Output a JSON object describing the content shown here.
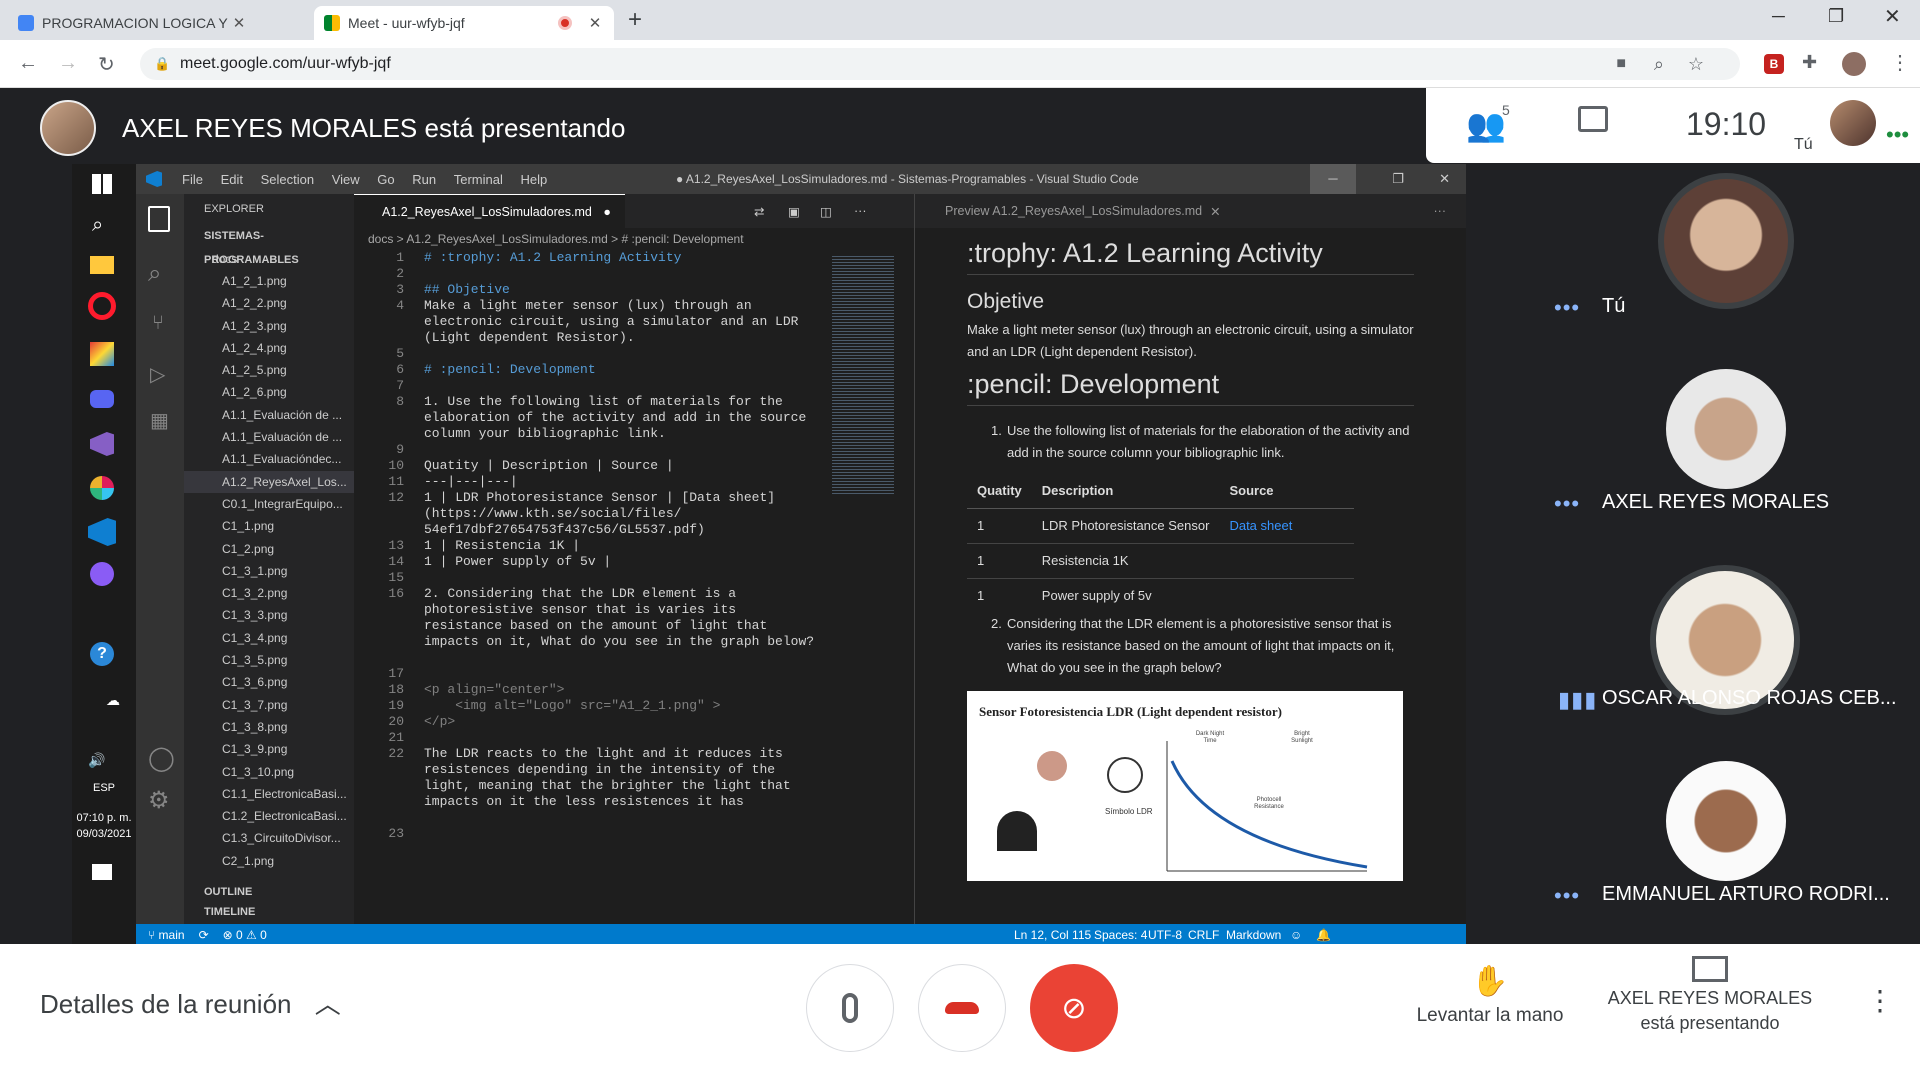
{
  "browser": {
    "tabs": [
      {
        "title": "PROGRAMACION LOGICA Y FUN",
        "icon": "classroom-icon",
        "active": false
      },
      {
        "title": "Meet - uur-wfyb-jqf",
        "icon": "meet-icon",
        "active": true
      }
    ],
    "url": "meet.google.com/uur-wfyb-jqf",
    "ext_badge": "B"
  },
  "meet": {
    "presenting_text": "AXEL REYES MORALES está presentando",
    "participants_count": "5",
    "time": "19:10",
    "you_label": "Tú",
    "participants": [
      {
        "name": "Tú",
        "status": "dots"
      },
      {
        "name": "AXEL REYES MORALES",
        "status": "dots"
      },
      {
        "name": "OSCAR ALONSO ROJAS CEB...",
        "status": "speaking"
      },
      {
        "name": "EMMANUEL ARTURO RODRI...",
        "status": "dots"
      }
    ],
    "details_label": "Detalles de la reunión",
    "raise_hand_label": "Levantar la mano",
    "presenting_line1": "AXEL REYES MORALES",
    "presenting_line2": "está presentando"
  },
  "taskbar": {
    "lang": "ESP",
    "time": "07:10 p. m.",
    "date": "09/03/2021"
  },
  "vscode": {
    "menu": [
      "File",
      "Edit",
      "Selection",
      "View",
      "Go",
      "Run",
      "Terminal",
      "Help"
    ],
    "title": "● A1.2_ReyesAxel_LosSimuladores.md - Sistemas-Programables - Visual Studio Code",
    "explorer_title": "EXPLORER",
    "workspace": "SISTEMAS-PROGRAMABLES",
    "folder": "docs",
    "files": [
      "A1_2_1.png",
      "A1_2_2.png",
      "A1_2_3.png",
      "A1_2_4.png",
      "A1_2_5.png",
      "A1_2_6.png",
      "A1.1_Evaluación de ...",
      "A1.1_Evaluación de ...",
      "A1.1_Evaluacióndec...",
      "A1.2_ReyesAxel_Los...",
      "C0.1_IntegrarEquipo...",
      "C1_1.png",
      "C1_2.png",
      "C1_3_1.png",
      "C1_3_2.png",
      "C1_3_3.png",
      "C1_3_4.png",
      "C1_3_5.png",
      "C1_3_6.png",
      "C1_3_7.png",
      "C1_3_8.png",
      "C1_3_9.png",
      "C1_3_10.png",
      "C1.1_ElectronicaBasi...",
      "C1.2_ElectronicaBasi...",
      "C1.3_CircuitoDivisor...",
      "C2_1.png"
    ],
    "outline": "OUTLINE",
    "timeline": "TIMELINE",
    "editor_tab": "A1.2_ReyesAxel_LosSimuladores.md",
    "breadcrumb": "docs > A1.2_ReyesAxel_LosSimuladores.md > # :pencil: Development",
    "preview_tab": "Preview A1.2_ReyesAxel_LosSimuladores.md",
    "code_lines": [
      {
        "n": "1",
        "t": "# :trophy: A1.2 Learning Activity",
        "c": "#569cd6"
      },
      {
        "n": "2",
        "t": "",
        "c": "#d4d4d4"
      },
      {
        "n": "3",
        "t": "## Objetive",
        "c": "#569cd6"
      },
      {
        "n": "4",
        "t": "Make a light meter sensor (lux) through an",
        "c": "#d4d4d4"
      },
      {
        "n": "",
        "t": "electronic circuit, using a simulator and an LDR",
        "c": "#d4d4d4"
      },
      {
        "n": "",
        "t": "(Light dependent Resistor).",
        "c": "#d4d4d4"
      },
      {
        "n": "5",
        "t": "",
        "c": "#d4d4d4"
      },
      {
        "n": "6",
        "t": "# :pencil: Development",
        "c": "#569cd6"
      },
      {
        "n": "7",
        "t": "",
        "c": "#d4d4d4"
      },
      {
        "n": "8",
        "t": "1. Use the following list of materials for the",
        "c": "#d4d4d4"
      },
      {
        "n": "",
        "t": "elaboration of the activity and add in the source",
        "c": "#d4d4d4"
      },
      {
        "n": "",
        "t": "column your bibliographic link.",
        "c": "#d4d4d4"
      },
      {
        "n": "9",
        "t": "",
        "c": "#d4d4d4"
      },
      {
        "n": "10",
        "t": "Quatity | Description | Source |",
        "c": "#d4d4d4"
      },
      {
        "n": "11",
        "t": "---|---|---|",
        "c": "#d4d4d4"
      },
      {
        "n": "12",
        "t": "1 | LDR Photoresistance Sensor | [Data sheet]",
        "c": "#d4d4d4"
      },
      {
        "n": "",
        "t": "(https://www.kth.se/social/files/",
        "c": "#d4d4d4"
      },
      {
        "n": "",
        "t": "54ef17dbf27654753f437c56/GL5537.pdf)",
        "c": "#d4d4d4"
      },
      {
        "n": "13",
        "t": "1 | Resistencia 1K |",
        "c": "#d4d4d4"
      },
      {
        "n": "14",
        "t": "1 | Power supply of 5v |",
        "c": "#d4d4d4"
      },
      {
        "n": "15",
        "t": "",
        "c": "#d4d4d4"
      },
      {
        "n": "16",
        "t": "2. Considering that the LDR element is a",
        "c": "#d4d4d4"
      },
      {
        "n": "",
        "t": "photoresistive sensor that is varies its",
        "c": "#d4d4d4"
      },
      {
        "n": "",
        "t": "resistance based on the amount of light that",
        "c": "#d4d4d4"
      },
      {
        "n": "",
        "t": "impacts on it, What do you see in the graph below?",
        "c": "#d4d4d4"
      },
      {
        "n": "",
        "t": "",
        "c": "#d4d4d4"
      },
      {
        "n": "17",
        "t": "",
        "c": "#d4d4d4"
      },
      {
        "n": "18",
        "t": "<p align=\"center\">",
        "c": "#808080"
      },
      {
        "n": "19",
        "t": "    <img alt=\"Logo\" src=\"A1_2_1.png\" >",
        "c": "#808080"
      },
      {
        "n": "20",
        "t": "</p>",
        "c": "#808080"
      },
      {
        "n": "21",
        "t": "",
        "c": "#d4d4d4"
      },
      {
        "n": "22",
        "t": "The LDR reacts to the light and it reduces its",
        "c": "#d4d4d4"
      },
      {
        "n": "",
        "t": "resistences depending in the intensity of the",
        "c": "#d4d4d4"
      },
      {
        "n": "",
        "t": "light, meaning that the brighter the light that",
        "c": "#d4d4d4"
      },
      {
        "n": "",
        "t": "impacts on it the less resistences it has",
        "c": "#d4d4d4"
      },
      {
        "n": "",
        "t": "",
        "c": "#d4d4d4"
      },
      {
        "n": "23",
        "t": "",
        "c": "#d4d4d4"
      }
    ],
    "preview": {
      "h1": ":trophy: A1.2 Learning Activity",
      "h2_objective": "Objetive",
      "objective_text": "Make a light meter sensor (lux) through an electronic circuit, using a simulator and an LDR (Light dependent Resistor).",
      "h1_dev": ":pencil: Development",
      "item1": "Use the following list of materials for the elaboration of the activity and add in the source column your bibliographic link.",
      "table_head": [
        "Quatity",
        "Description",
        "Source"
      ],
      "table_rows": [
        [
          "1",
          "LDR Photoresistance Sensor",
          "Data sheet"
        ],
        [
          "1",
          "Resistencia 1K",
          ""
        ],
        [
          "1",
          "Power supply of 5v",
          ""
        ]
      ],
      "item2": "Considering that the LDR element is a photoresistive sensor that is varies its resistance based on the amount of light that impacts on it, What do you see in the graph below?",
      "image_caption": "Sensor Fotoresistencia LDR (Light dependent resistor)",
      "image_label_symbol": "Símbolo LDR",
      "image_label_curve": "Photocell Resistance",
      "image_label_dark": "Dark Night Time",
      "image_label_bright": "Bright Sunlight"
    },
    "status": {
      "branch": "main",
      "errors": "⊗ 0 ⚠ 0",
      "position": "Ln 12, Col 115",
      "spaces": "Spaces: 4",
      "encoding": "UTF-8",
      "eol": "CRLF",
      "lang": "Markdown"
    }
  },
  "colors": {
    "meet_bg": "#202124",
    "vscode_blue": "#007acc",
    "end_call_red": "#ea4335",
    "accent_blue": "#8ab4f8"
  }
}
